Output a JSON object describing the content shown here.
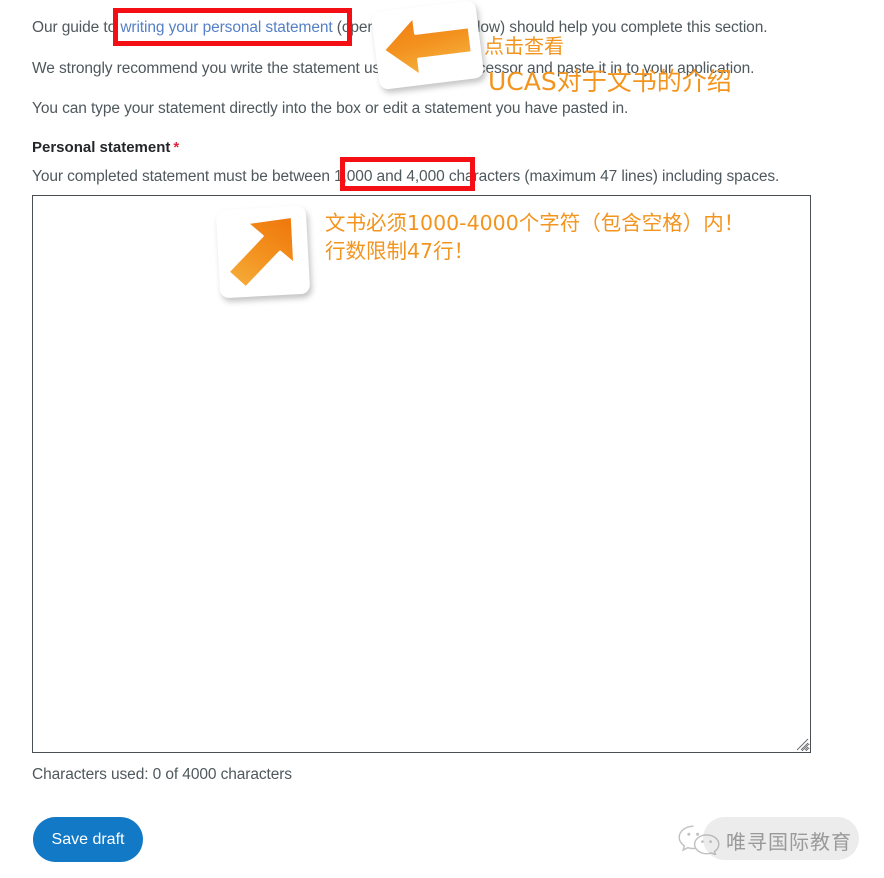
{
  "intro": {
    "para_1_before": "Our guide to ",
    "para_1_link": "writing your personal statement",
    "para_1_after": " (opens in a new window) should help you complete this section.",
    "para_2": "We strongly recommend you write the statement using a word-processor and paste it in to your application.",
    "para_3": "You can type your statement directly into the box or edit a statement you have pasted in."
  },
  "form": {
    "label": "Personal statement",
    "required_marker": "*",
    "hint": "Your completed statement must be between 1,000 and 4,000 characters (maximum 47 lines) including spaces.",
    "textarea_value": "",
    "textarea_placeholder": "",
    "character_counter": "Characters used: 0 of 4000 characters",
    "save_draft_label": "Save draft",
    "min_characters": 1000,
    "max_characters": 4000,
    "max_lines": 47,
    "characters_used": 0
  },
  "annotations": {
    "red_box_link_target": "writing your personal statement",
    "red_box_charlimit_target": "1,000 and 4,000",
    "note_top_line_1": "点击查看",
    "note_top_line_2": "UCAS对于文书的介绍",
    "note_mid_line_1": "文书必须1000-4000个字符（包含空格）内！",
    "note_mid_line_2": "行数限制47行！"
  },
  "watermark": {
    "label": "唯寻国际教育",
    "icon": "wechat-icon"
  },
  "colors": {
    "annotation_orange": "#f2941e",
    "annotation_red": "#f40f14",
    "link_blue": "#5580c6",
    "button_blue": "#1279c6",
    "required_red": "#e2273c",
    "body_text": "#4e585d",
    "heading_text": "#23262a",
    "watermark_gray": "#9a9a9a"
  }
}
